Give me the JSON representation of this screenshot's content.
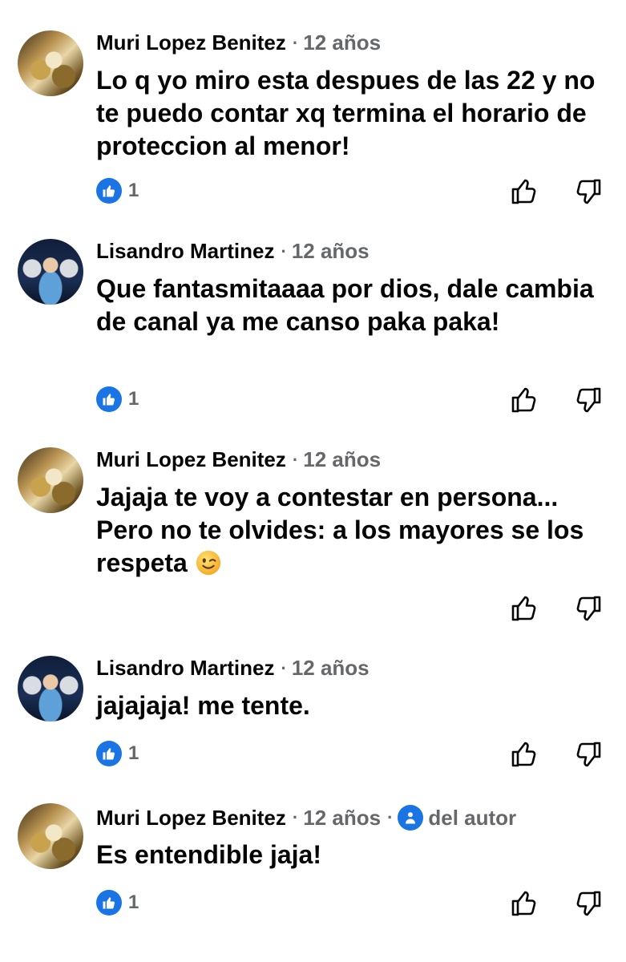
{
  "comments": [
    {
      "author": "Muri Lopez Benitez",
      "avatar_icon": "avatar-photo",
      "time": "12 años",
      "text": "Lo q yo miro esta despues de las 22 y no te puedo contar xq termina el horario de proteccion al menor!",
      "likes": "1"
    },
    {
      "author": "Lisandro Martinez",
      "avatar_icon": "avatar-photo",
      "time": "12 años",
      "text": "Que fantasmitaaaa por dios, dale cambia de canal ya me canso paka paka!",
      "likes": "1"
    },
    {
      "author": "Muri Lopez Benitez",
      "avatar_icon": "avatar-photo",
      "time": "12 años",
      "text": "Jajaja te voy a contestar en persona... Pero no te olvides: a los mayores se los respeta",
      "emoji": "winking-face-emoji"
    },
    {
      "author": "Lisandro Martinez",
      "avatar_icon": "avatar-photo",
      "time": "12 años",
      "text": "jajajaja! me tente.",
      "likes": "1"
    },
    {
      "author": "Muri Lopez Benitez",
      "avatar_icon": "avatar-photo",
      "time": "12 años",
      "author_badge": "del autor",
      "text": "Es entendible jaja!",
      "likes": "1"
    }
  ],
  "colors": {
    "accent": "#1b74e4",
    "secondary_text": "#65676b",
    "primary_text": "#050505"
  },
  "icons": {
    "like_reaction": "thumbs-up-icon",
    "upvote": "thumbs-up-outline-icon",
    "downvote": "thumbs-down-outline-icon"
  }
}
